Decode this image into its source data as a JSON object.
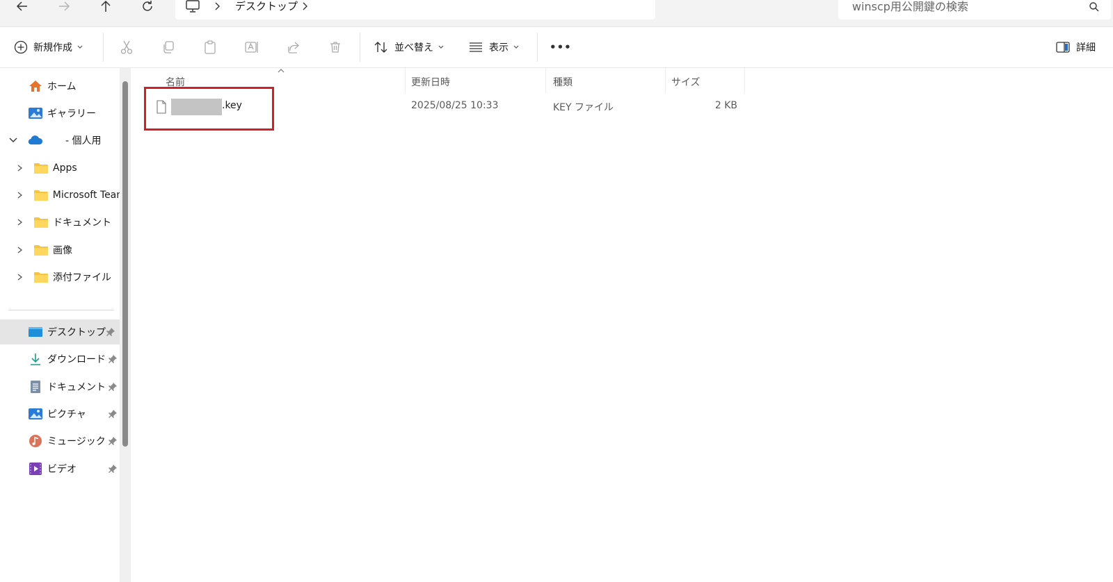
{
  "address": {
    "breadcrumb": [
      "デスクトップ"
    ],
    "search_placeholder": "winscp用公開鍵の検索"
  },
  "toolbar": {
    "new_label": "新規作成",
    "sort_label": "並べ替え",
    "view_label": "表示",
    "more_label": "•••",
    "details_label": "詳細"
  },
  "sidebar": {
    "items": [
      {
        "label": "ホーム",
        "icon": "home-icon"
      },
      {
        "label": "ギャラリー",
        "icon": "gallery-icon"
      },
      {
        "label": "- 個人用",
        "icon": "onedrive-cloud-icon"
      },
      {
        "label": "Apps",
        "icon": "folder-icon"
      },
      {
        "label": "Microsoft Team",
        "icon": "folder-icon"
      },
      {
        "label": "ドキュメント",
        "icon": "folder-icon"
      },
      {
        "label": "画像",
        "icon": "folder-icon"
      },
      {
        "label": "添付ファイル",
        "icon": "folder-icon"
      }
    ],
    "quick_access": [
      {
        "label": "デスクトップ",
        "icon": "desktop-icon"
      },
      {
        "label": "ダウンロード",
        "icon": "download-icon"
      },
      {
        "label": "ドキュメント",
        "icon": "documents-icon"
      },
      {
        "label": "ピクチャ",
        "icon": "pictures-icon"
      },
      {
        "label": "ミュージック",
        "icon": "music-icon"
      },
      {
        "label": "ビデオ",
        "icon": "video-icon"
      }
    ]
  },
  "list": {
    "headers": {
      "name": "名前",
      "modified": "更新日時",
      "type": "種類",
      "size": "サイズ"
    },
    "rows": [
      {
        "name": ".key",
        "modified": "2025/08/25 10:33",
        "type": "KEY ファイル",
        "size": "2 KB"
      }
    ]
  },
  "colors": {
    "highlight_border": "#d0202a",
    "folder": "#f6c445",
    "selected_bg": "#e5e5e5"
  }
}
